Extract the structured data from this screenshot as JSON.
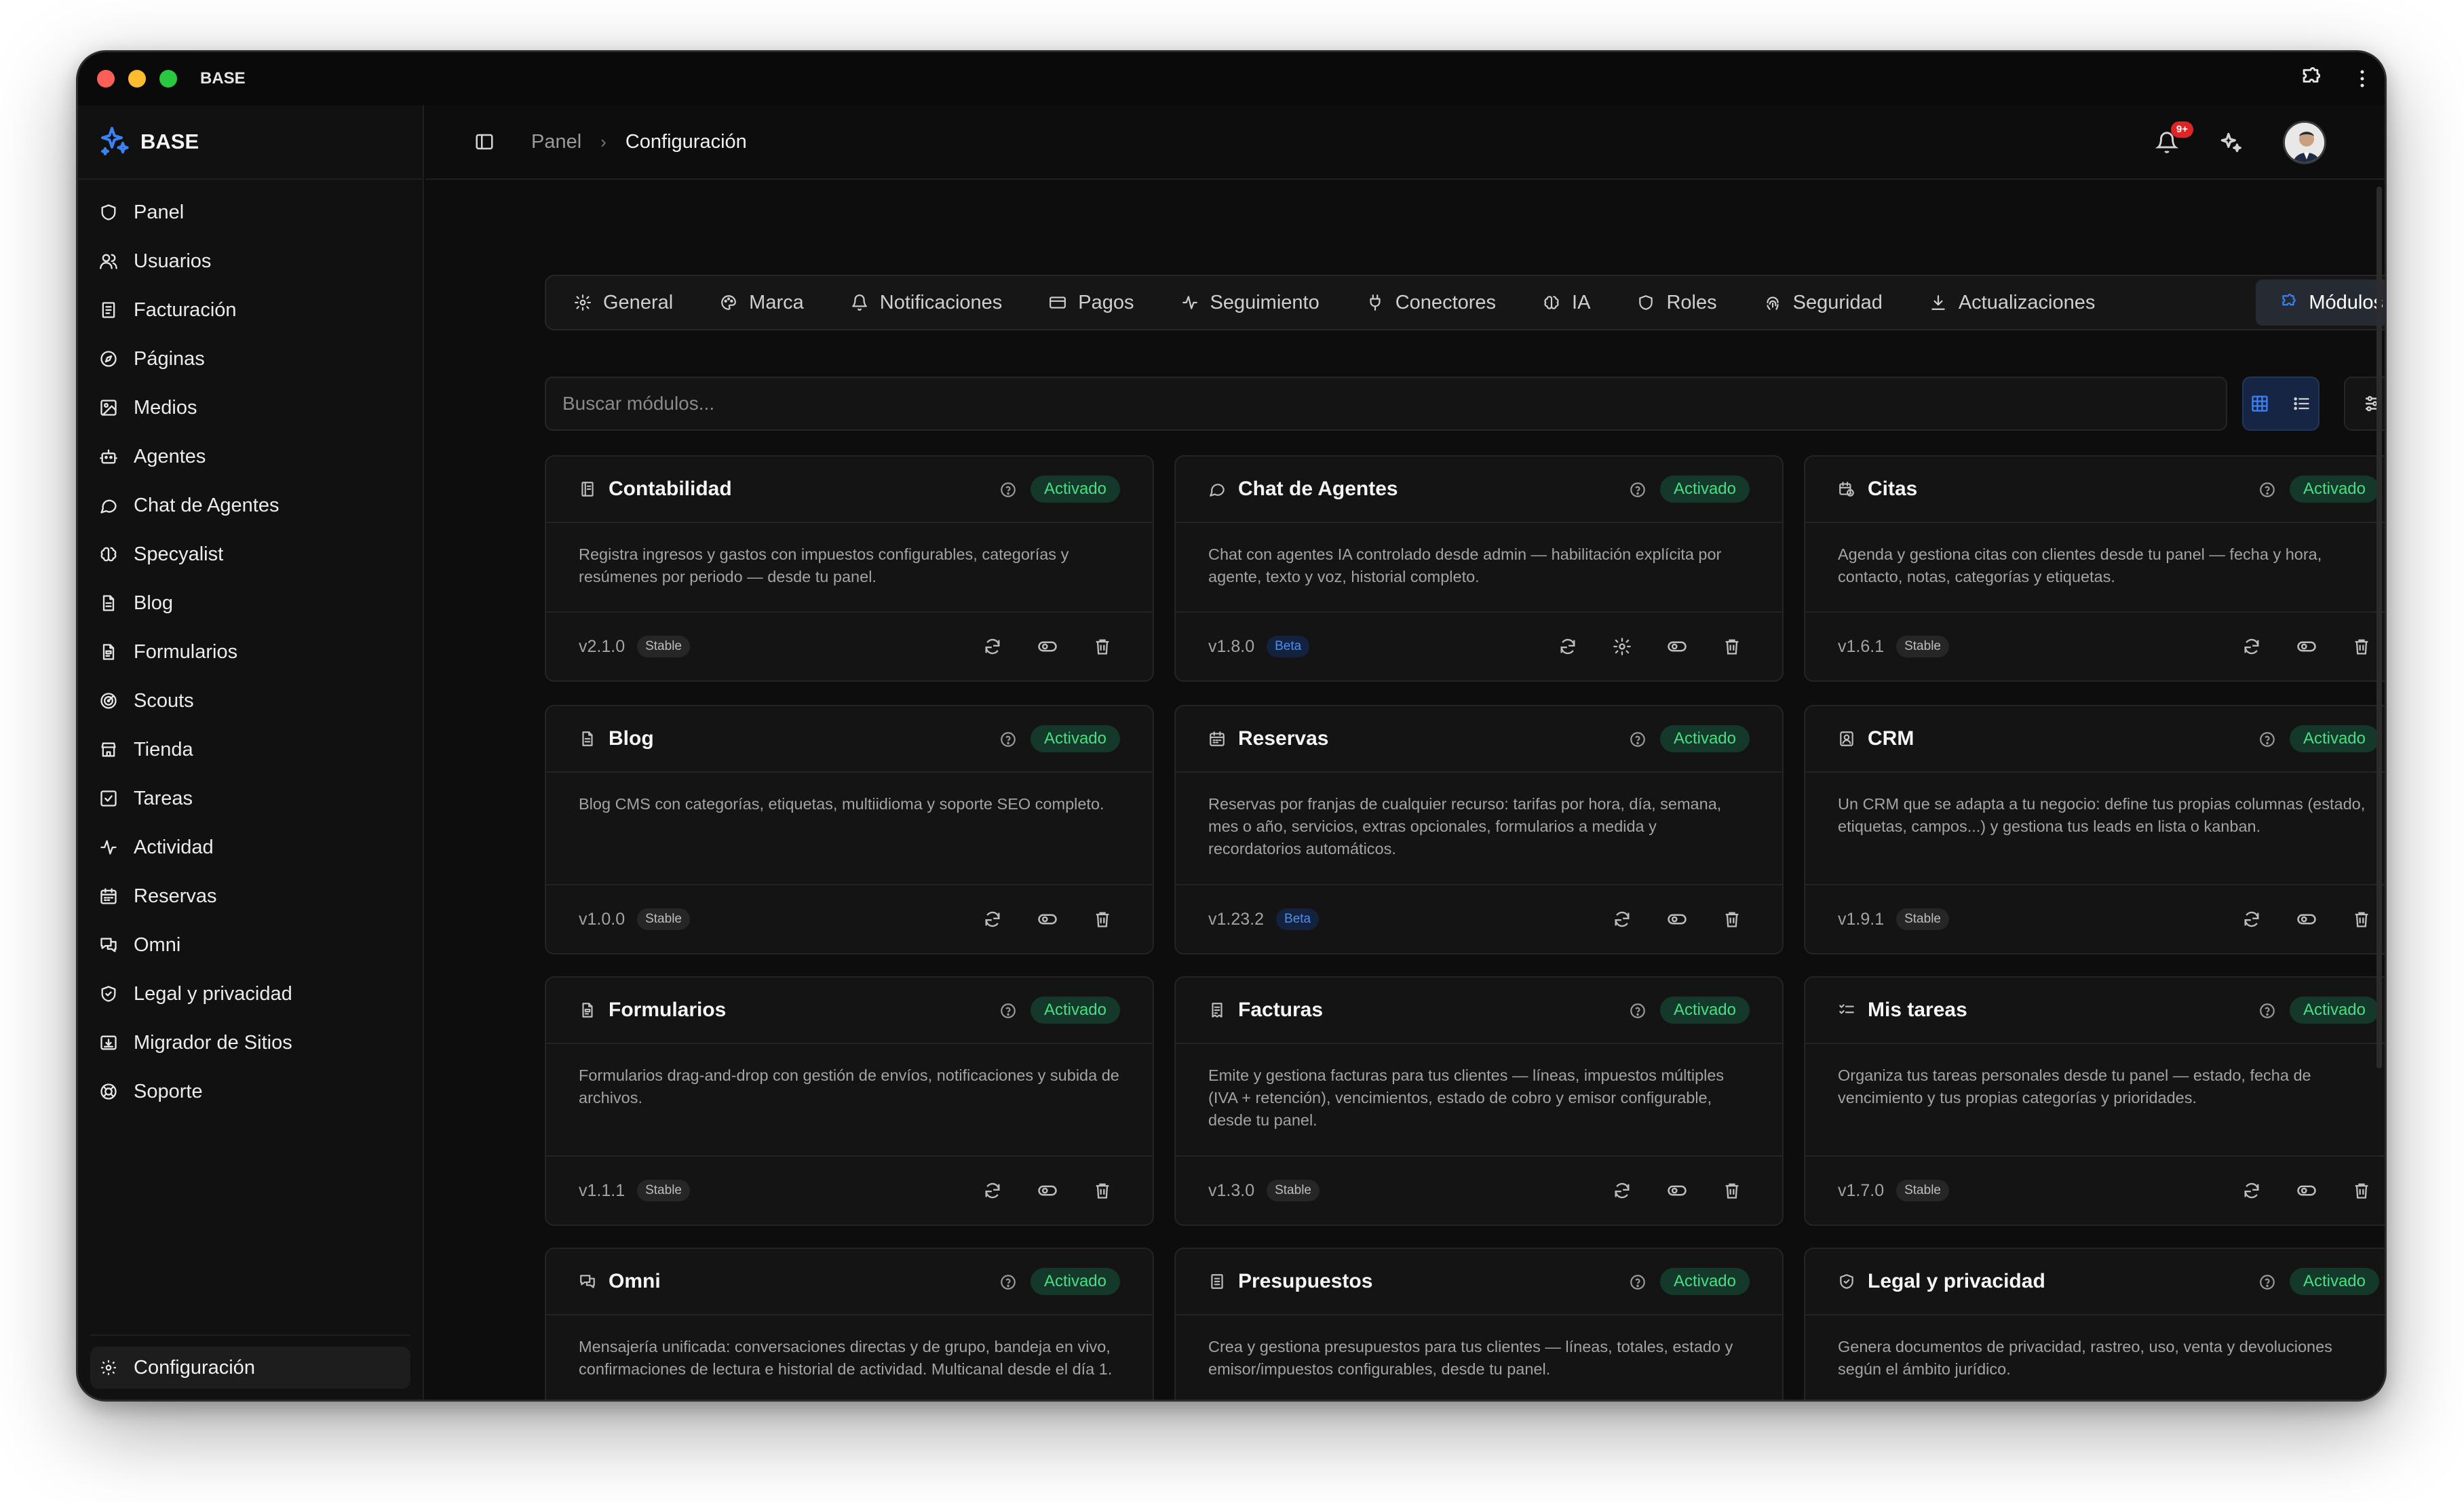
{
  "window": {
    "title": "BASE"
  },
  "sidebar": {
    "brand": "BASE",
    "items": [
      {
        "label": "Panel",
        "icon": "shield-icon"
      },
      {
        "label": "Usuarios",
        "icon": "users-icon"
      },
      {
        "label": "Facturación",
        "icon": "receipt-icon"
      },
      {
        "label": "Páginas",
        "icon": "compass-icon"
      },
      {
        "label": "Medios",
        "icon": "image-icon"
      },
      {
        "label": "Agentes",
        "icon": "bot-icon"
      },
      {
        "label": "Chat de Agentes",
        "icon": "chat-icon"
      },
      {
        "label": "Specyalist",
        "icon": "brain-icon"
      },
      {
        "label": "Blog",
        "icon": "document-icon"
      },
      {
        "label": "Formularios",
        "icon": "form-icon"
      },
      {
        "label": "Scouts",
        "icon": "radar-icon"
      },
      {
        "label": "Tienda",
        "icon": "store-icon"
      },
      {
        "label": "Tareas",
        "icon": "checkbox-icon"
      },
      {
        "label": "Actividad",
        "icon": "activity-icon"
      },
      {
        "label": "Reservas",
        "icon": "calendar-icon"
      },
      {
        "label": "Omni",
        "icon": "messages-icon"
      },
      {
        "label": "Legal y privacidad",
        "icon": "shield-check-icon"
      },
      {
        "label": "Migrador de Sitios",
        "icon": "migrate-icon"
      },
      {
        "label": "Soporte",
        "icon": "lifebuoy-icon"
      }
    ],
    "bottom": {
      "label": "Configuración",
      "icon": "gear-icon"
    }
  },
  "header": {
    "breadcrumb": [
      "Panel",
      "Configuración"
    ],
    "notifications_badge": "9+"
  },
  "tabs": [
    {
      "label": "General",
      "icon": "gear-icon"
    },
    {
      "label": "Marca",
      "icon": "palette-icon"
    },
    {
      "label": "Notificaciones",
      "icon": "bell-icon"
    },
    {
      "label": "Pagos",
      "icon": "card-icon"
    },
    {
      "label": "Seguimiento",
      "icon": "activity-icon"
    },
    {
      "label": "Conectores",
      "icon": "plug-icon"
    },
    {
      "label": "IA",
      "icon": "brain-icon"
    },
    {
      "label": "Roles",
      "icon": "shield-icon"
    },
    {
      "label": "Seguridad",
      "icon": "fingerprint-icon"
    },
    {
      "label": "Actualizaciones",
      "icon": "download-icon"
    },
    {
      "label": "Módulos",
      "icon": "puzzle-icon",
      "active": true
    }
  ],
  "search": {
    "placeholder": "Buscar módulos..."
  },
  "colors": {
    "accent": "#3b82f6",
    "active_status": "#4ade80",
    "beta": "#4d8ef0",
    "badge": "#dc2626"
  },
  "modules": [
    {
      "title": "Contabilidad",
      "icon": "ledger-icon",
      "status": "Activado",
      "desc": "Registra ingresos y gastos con impuestos configurables, categorías y resúmenes por periodo — desde tu panel.",
      "version": "v2.1.0",
      "channel": "Stable",
      "settings": false
    },
    {
      "title": "Chat de Agentes",
      "icon": "chat-icon",
      "status": "Activado",
      "desc": "Chat con agentes IA controlado desde admin — habilitación explícita por agente, texto y voz, historial completo.",
      "version": "v1.8.0",
      "channel": "Beta",
      "settings": true
    },
    {
      "title": "Citas",
      "icon": "calendar-clock-icon",
      "status": "Activado",
      "desc": "Agenda y gestiona citas con clientes desde tu panel — fecha y hora, contacto, notas, categorías y etiquetas.",
      "version": "v1.6.1",
      "channel": "Stable",
      "settings": false
    },
    {
      "title": "Blog",
      "icon": "document-icon",
      "status": "Activado",
      "desc": "Blog CMS con categorías, etiquetas, multiidioma y soporte SEO completo.",
      "version": "v1.0.0",
      "channel": "Stable",
      "settings": false
    },
    {
      "title": "Reservas",
      "icon": "calendar-icon",
      "status": "Activado",
      "desc": "Reservas por franjas de cualquier recurso: tarifas por hora, día, semana, mes o año, servicios, extras opcionales, formularios a medida y recordatorios automáticos.",
      "version": "v1.23.2",
      "channel": "Beta",
      "settings": false
    },
    {
      "title": "CRM",
      "icon": "contact-icon",
      "status": "Activado",
      "desc": "Un CRM que se adapta a tu negocio: define tus propias columnas (estado, etiquetas, campos...) y gestiona tus leads en lista o kanban.",
      "version": "v1.9.1",
      "channel": "Stable",
      "settings": false
    },
    {
      "title": "Formularios",
      "icon": "form-icon",
      "status": "Activado",
      "desc": "Formularios drag-and-drop con gestión de envíos, notificaciones y subida de archivos.",
      "version": "v1.1.1",
      "channel": "Stable",
      "settings": false
    },
    {
      "title": "Facturas",
      "icon": "invoice-icon",
      "status": "Activado",
      "desc": "Emite y gestiona facturas para tus clientes — líneas, impuestos múltiples (IVA + retención), vencimientos, estado de cobro y emisor configurable, desde tu panel.",
      "version": "v1.3.0",
      "channel": "Stable",
      "settings": false
    },
    {
      "title": "Mis tareas",
      "icon": "list-check-icon",
      "status": "Activado",
      "desc": "Organiza tus tareas personales desde tu panel — estado, fecha de vencimiento y tus propias categorías y prioridades.",
      "version": "v1.7.0",
      "channel": "Stable",
      "settings": false
    },
    {
      "title": "Omni",
      "icon": "messages-icon",
      "status": "Activado",
      "desc": "Mensajería unificada: conversaciones directas y de grupo, bandeja en vivo, confirmaciones de lectura e historial de actividad. Multicanal desde el día 1.",
      "version": "",
      "channel": "",
      "settings": false
    },
    {
      "title": "Presupuestos",
      "icon": "quote-icon",
      "status": "Activado",
      "desc": "Crea y gestiona presupuestos para tus clientes — líneas, totales, estado y emisor/impuestos configurables, desde tu panel.",
      "version": "",
      "channel": "",
      "settings": false
    },
    {
      "title": "Legal y privacidad",
      "icon": "shield-check-icon",
      "status": "Activado",
      "desc": "Genera documentos de privacidad, rastreo, uso, venta y devoluciones según el ámbito jurídico.",
      "version": "",
      "channel": "",
      "settings": false
    }
  ]
}
